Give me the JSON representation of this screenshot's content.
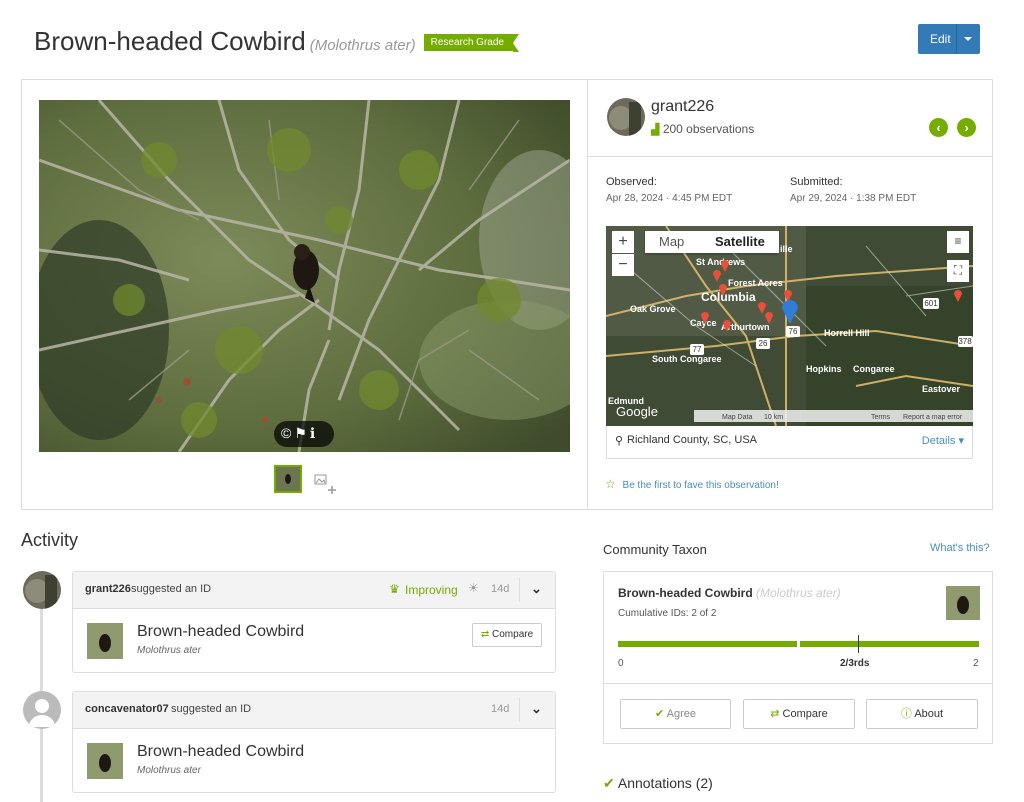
{
  "header": {
    "common_name": "Brown-headed Cowbird",
    "scientific_name": "(Molothrus ater)",
    "quality_badge": "Research Grade",
    "edit_label": "Edit"
  },
  "photo": {
    "controls": "©⚑ℹ"
  },
  "observer": {
    "username": "grant226",
    "observations": "200 observations"
  },
  "dates": {
    "observed_label": "Observed:",
    "observed_value": "Apr 28, 2024 · 4:45 PM EDT",
    "submitted_label": "Submitted:",
    "submitted_value": "Apr 29, 2024 · 1:38 PM EDT"
  },
  "map": {
    "tab_map": "Map",
    "tab_satellite": "Satellite",
    "zoom_in": "+",
    "zoom_out": "−",
    "labels": [
      "St Andrews",
      "Forest Acres",
      "Columbia",
      "Oak Grove",
      "Cayce",
      "Arthurtown",
      "Horrell Hill",
      "South Congaree",
      "Hopkins",
      "Congaree",
      "Eastover",
      "Edmund",
      "ille"
    ],
    "shields": [
      "601",
      "378",
      "77",
      "76",
      "26"
    ],
    "google": "Google",
    "attribution": [
      "Map Data",
      "10 km",
      "Terms",
      "Report a map error"
    ],
    "location": "Richland County, SC, USA",
    "details": "Details"
  },
  "fave_text": "Be the first to fave this observation!",
  "activity": {
    "heading": "Activity",
    "items": [
      {
        "user": "grant226",
        "action": "suggested an ID",
        "status": "Improving",
        "age": "14d",
        "taxon": "Brown-headed Cowbird",
        "sci": "Molothrus ater",
        "compare": "Compare"
      },
      {
        "user": "concavenator07",
        "action": "suggested an ID",
        "age": "14d",
        "taxon": "Brown-headed Cowbird",
        "sci": "Molothrus ater"
      }
    ]
  },
  "community": {
    "heading": "Community Taxon",
    "whats_this": "What's this?",
    "taxon": "Brown-headed Cowbird",
    "sci": "(Molothrus ater)",
    "cumulative": "Cumulative IDs: 2 of 2",
    "scale_min": "0",
    "scale_mid": "2/3rds",
    "scale_max": "2",
    "agree": "Agree",
    "compare": "Compare",
    "about": "About"
  },
  "annotations": "Annotations (2)",
  "colors": {
    "accent": "#74ac00",
    "link": "#4a8dc0",
    "edit": "#337ab7"
  }
}
